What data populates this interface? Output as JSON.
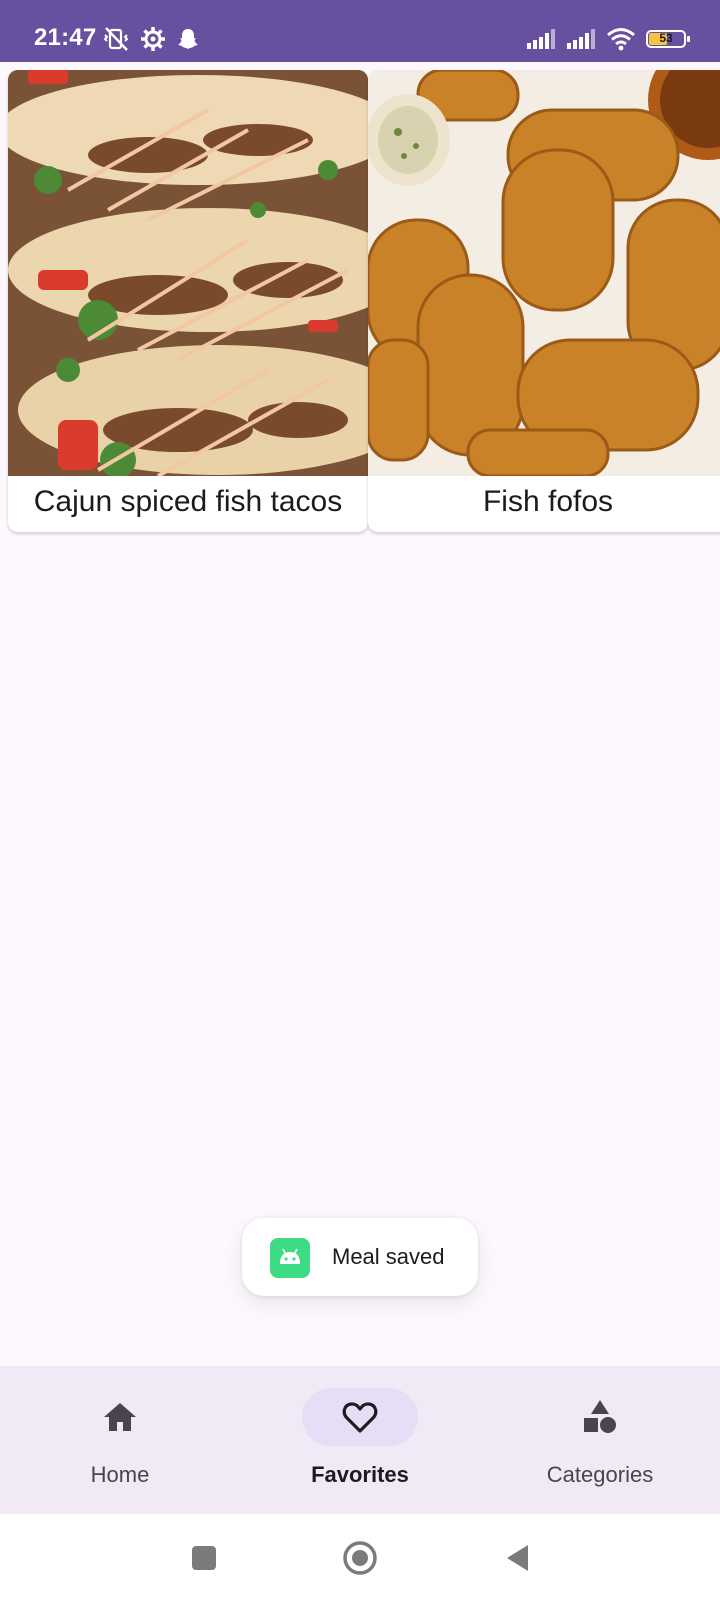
{
  "status_bar": {
    "time": "21:47",
    "left_icons": [
      "vibrate-off-icon",
      "settings-gear-icon",
      "snapchat-icon"
    ],
    "right_icons": [
      "signal-icon",
      "signal-icon",
      "wifi-icon",
      "battery-icon"
    ],
    "battery_level": "53",
    "battery_fraction": 0.53,
    "colors": {
      "bar": "#66509f",
      "battery": "#f6c343"
    }
  },
  "meals": [
    {
      "title": "Cajun spiced fish tacos",
      "image": "fish-tacos-photo"
    },
    {
      "title": "Fish fofos",
      "image": "fish-fofos-photo"
    }
  ],
  "toast": {
    "text": "Meal saved",
    "icon": "android-app-icon",
    "icon_color": "#3ddc84"
  },
  "bottom_nav": {
    "items": [
      {
        "label": "Home",
        "icon": "home-icon",
        "active": false
      },
      {
        "label": "Favorites",
        "icon": "heart-outline-icon",
        "active": true
      },
      {
        "label": "Categories",
        "icon": "shapes-icon",
        "active": false
      }
    ],
    "colors": {
      "background": "#f1e9f6",
      "active_pill": "#e7ddf7"
    }
  },
  "system_nav": {
    "icons": [
      "recents-square-icon",
      "home-circle-icon",
      "back-triangle-icon"
    ]
  }
}
